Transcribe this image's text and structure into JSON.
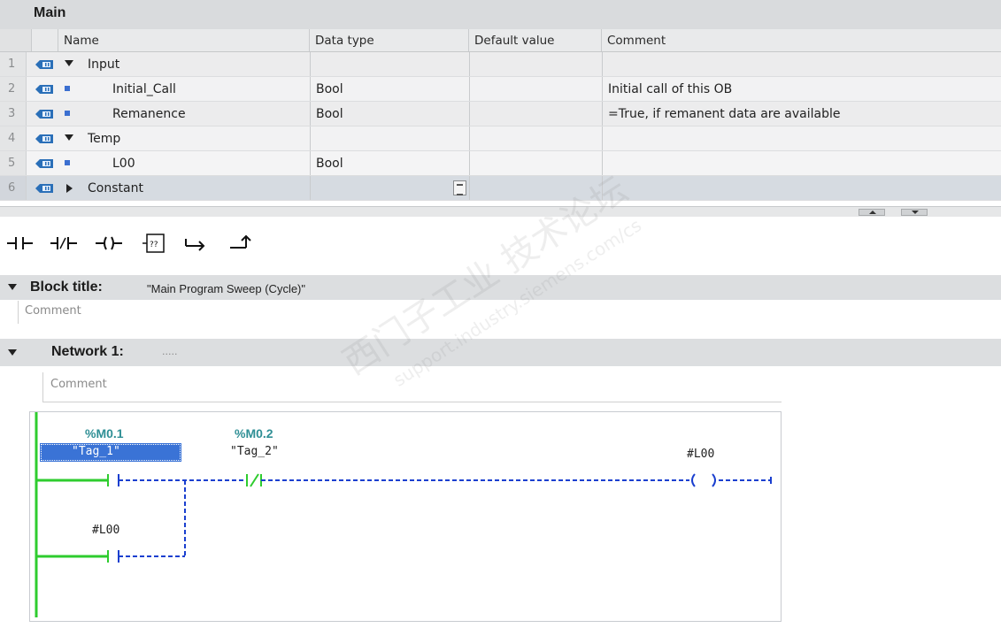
{
  "block": {
    "title": "Main"
  },
  "interface": {
    "columns": [
      "Name",
      "Data type",
      "Default value",
      "Comment"
    ],
    "rows": [
      {
        "num": "1",
        "kind": "section",
        "expanded": true,
        "name": "Input",
        "datatype": "",
        "default": "",
        "comment": ""
      },
      {
        "num": "2",
        "kind": "item",
        "name": "Initial_Call",
        "datatype": "Bool",
        "default": "",
        "comment": "Initial call of this OB"
      },
      {
        "num": "3",
        "kind": "item",
        "name": "Remanence",
        "datatype": "Bool",
        "default": "",
        "comment": "=True, if remanent data are available"
      },
      {
        "num": "4",
        "kind": "section",
        "expanded": true,
        "name": "Temp",
        "datatype": "",
        "default": "",
        "comment": ""
      },
      {
        "num": "5",
        "kind": "item",
        "name": "L00",
        "datatype": "Bool",
        "default": "",
        "comment": ""
      },
      {
        "num": "6",
        "kind": "section",
        "expanded": false,
        "name": "Constant",
        "datatype": "",
        "default": "",
        "comment": ""
      }
    ]
  },
  "toolbar": {
    "items": [
      {
        "name": "no-contact-button",
        "icon": "normally-open-contact-icon"
      },
      {
        "name": "nc-contact-button",
        "icon": "normally-closed-contact-icon"
      },
      {
        "name": "coil-button",
        "icon": "coil-icon"
      },
      {
        "name": "empty-box-button",
        "icon": "empty-box-icon",
        "label": "??"
      },
      {
        "name": "open-branch-button",
        "icon": "open-branch-icon"
      },
      {
        "name": "close-branch-button",
        "icon": "close-branch-icon"
      }
    ]
  },
  "block_title": {
    "label": "Block title:",
    "value": "\"Main Program Sweep (Cycle)\"",
    "comment_placeholder": "Comment"
  },
  "network": {
    "label": "Network 1:",
    "title_placeholder": ".....",
    "comment_placeholder": "Comment",
    "contact1": {
      "address": "%M0.1",
      "tag": "\"Tag_1\""
    },
    "contact2": {
      "address": "%M0.2",
      "tag": "\"Tag_2\""
    },
    "coil": {
      "tag": "#L00"
    },
    "branch_contact": {
      "tag": "#L00"
    }
  },
  "watermark": {
    "line1": "西门子工业 技术论坛",
    "line2": "support.industry.siemens.com/cs"
  },
  "colors": {
    "power_rail": "#2ecc2e",
    "wire_unpowered": "#1a3fcf",
    "address": "#2f8f95",
    "selection": "#3a73d6"
  }
}
